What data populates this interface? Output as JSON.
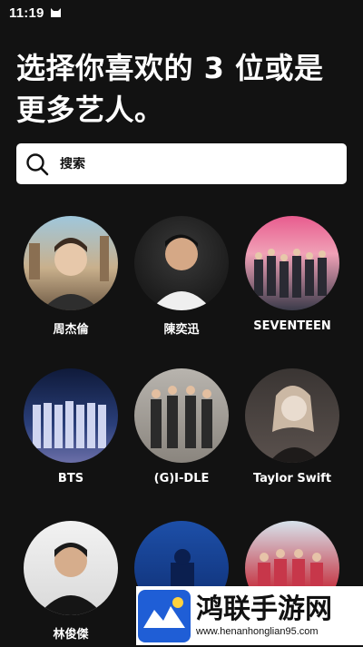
{
  "status_bar": {
    "time": "11:19",
    "notification_icon": "cat-icon"
  },
  "header": {
    "title": "选择你喜欢的 3 位或是更多艺人。"
  },
  "search": {
    "placeholder": "搜索",
    "icon": "search-icon"
  },
  "artists": [
    {
      "name": "周杰倫",
      "image": "castle-portrait"
    },
    {
      "name": "陳奕迅",
      "image": "portrait"
    },
    {
      "name": "SEVENTEEN",
      "image": "group-photo"
    },
    {
      "name": "BTS",
      "image": "group-photo"
    },
    {
      "name": "(G)I-DLE",
      "image": "group-photo"
    },
    {
      "name": "Taylor Swift",
      "image": "portrait"
    },
    {
      "name": "林俊傑",
      "image": "portrait"
    },
    {
      "name": "",
      "image": "album-art"
    },
    {
      "name": "",
      "image": "group-photo"
    }
  ],
  "watermark": {
    "title": "鸿联手游网",
    "url": "www.henanhonglian95.com"
  },
  "colors": {
    "background": "#121212",
    "search_bg": "#ffffff",
    "text": "#ffffff"
  }
}
